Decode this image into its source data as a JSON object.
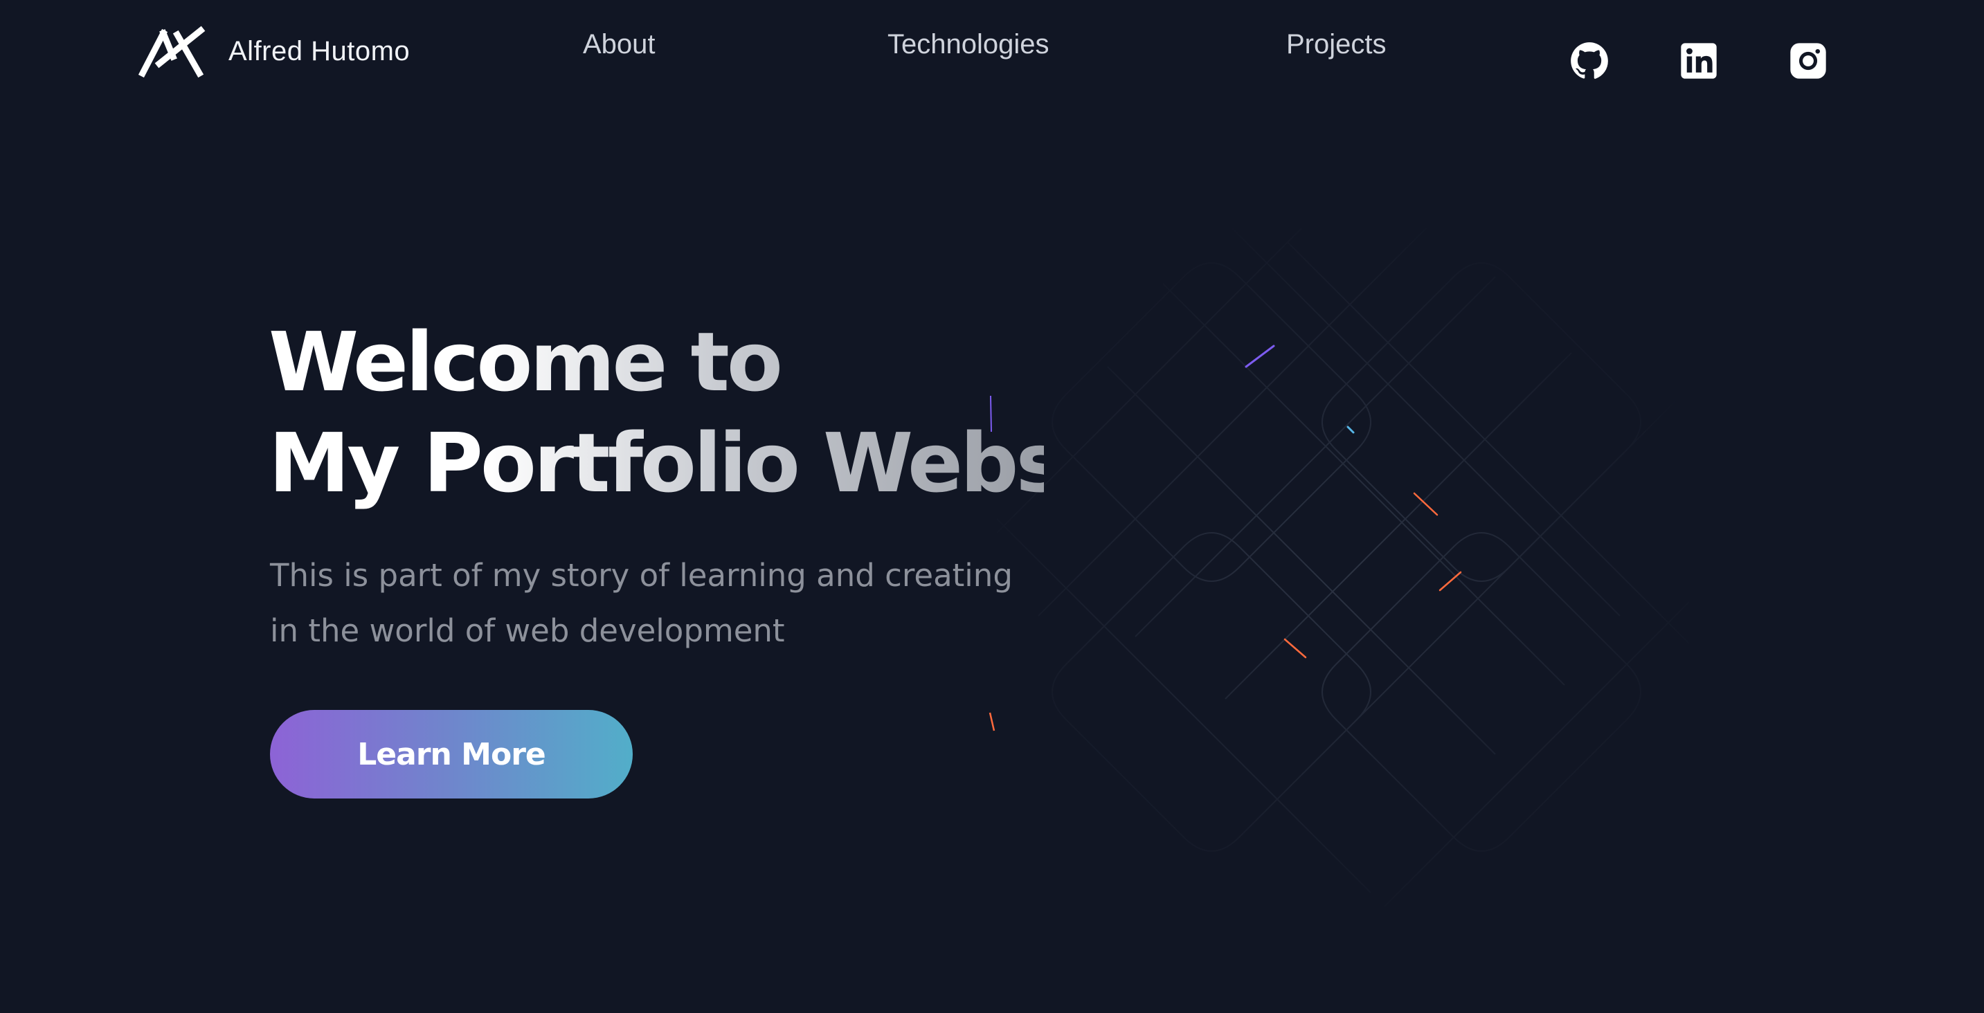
{
  "nav": {
    "brand_name": "Alfred Hutomo",
    "links": [
      {
        "label": "About"
      },
      {
        "label": "Technologies"
      },
      {
        "label": "Projects"
      }
    ],
    "social": [
      {
        "icon": "github-icon"
      },
      {
        "icon": "linkedin-icon"
      },
      {
        "icon": "instagram-icon"
      }
    ]
  },
  "hero": {
    "title_line1": "Welcome to",
    "title_line2": "My Portfolio Website",
    "subtitle_line1": "This is part of my story of learning and creating",
    "subtitle_line2": "in the world of web development",
    "cta_label": "Learn More"
  },
  "colors": {
    "background": "#111624",
    "nav_text": "#cfd3dc",
    "subtitle_text": "#8d919b",
    "cta_gradient_start": "#8d63d6",
    "cta_gradient_end": "#52aec9",
    "accent_purple": "#7d5cf0",
    "accent_blue": "#58b6e6",
    "accent_orange": "#ff6a3d"
  }
}
